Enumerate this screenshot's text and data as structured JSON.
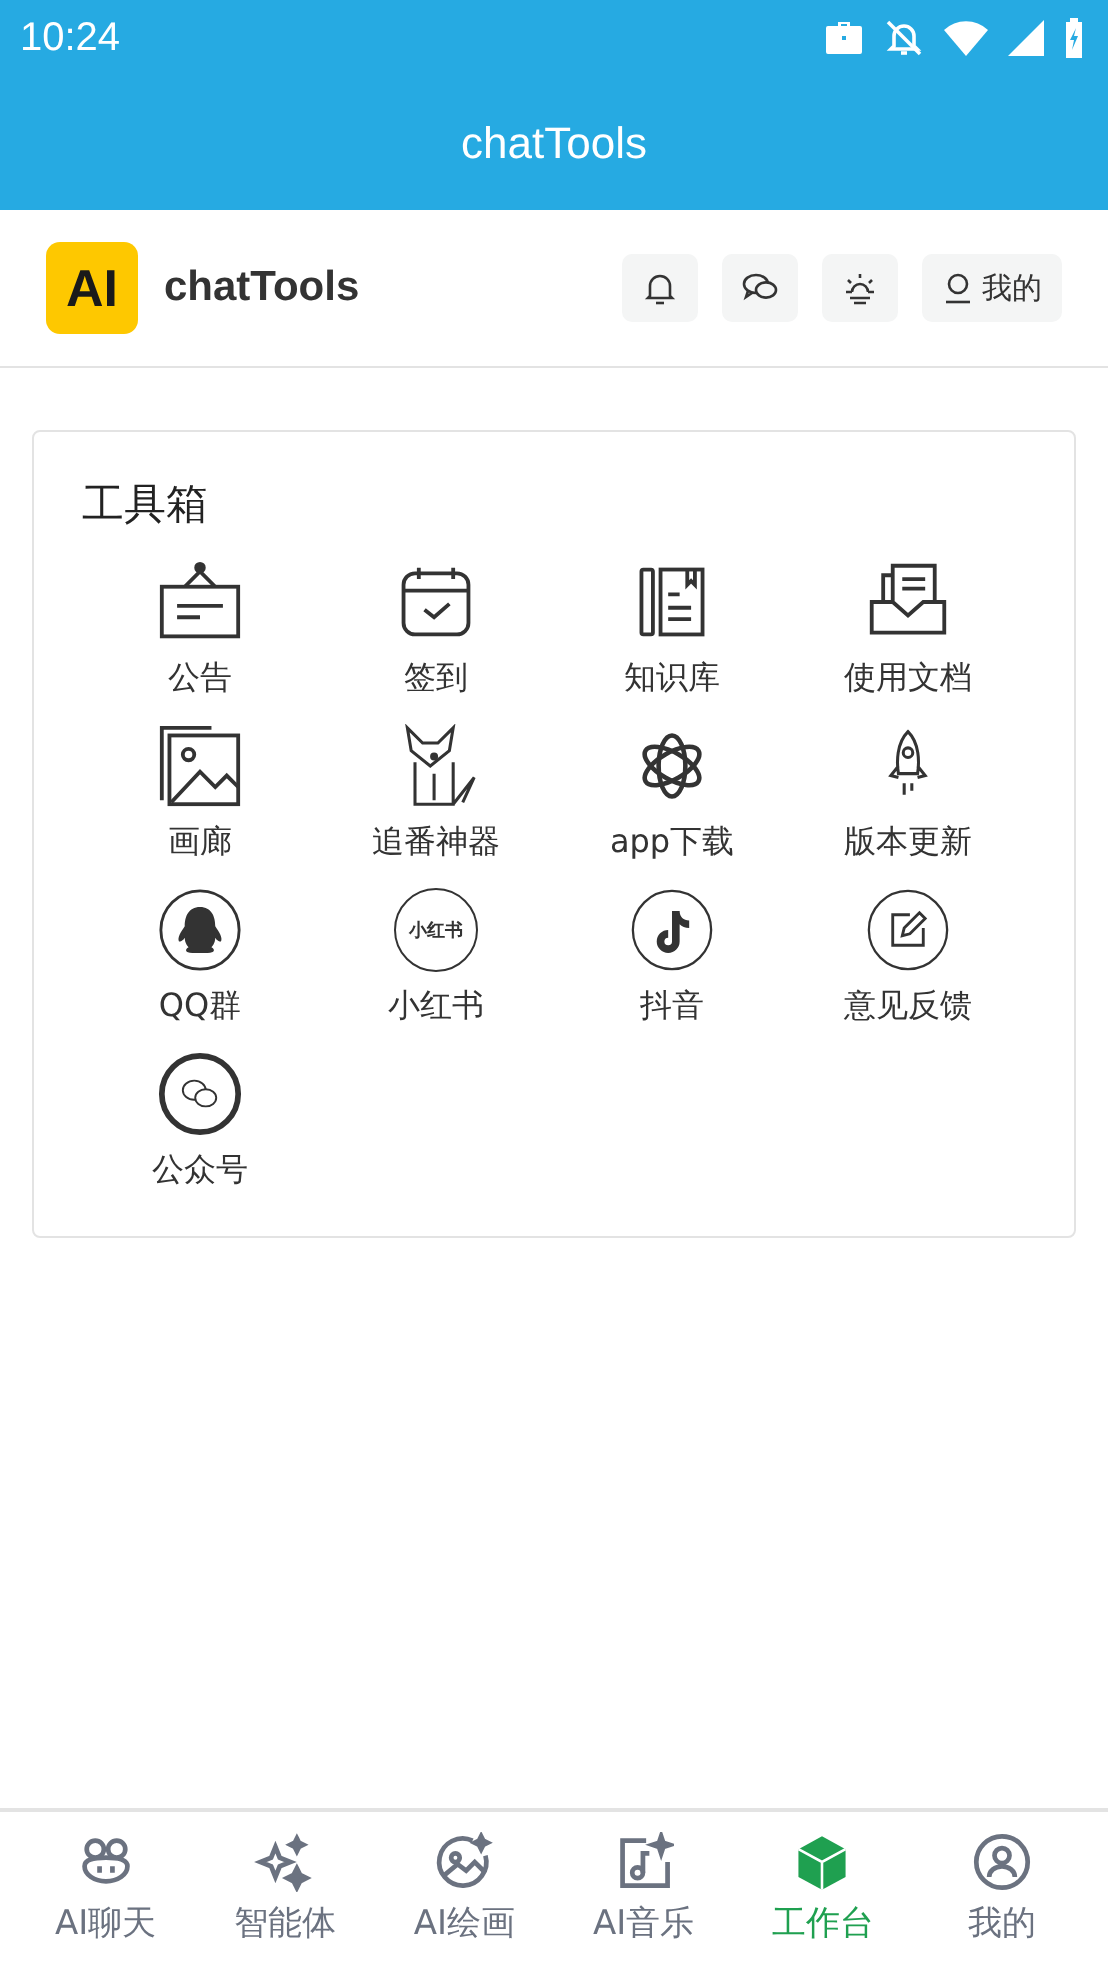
{
  "status_bar": {
    "time": "10:24"
  },
  "title_bar": {
    "title": "chatTools"
  },
  "app_header": {
    "logo_text": "AI",
    "name": "chatTools",
    "profile_label": "我的"
  },
  "toolbox": {
    "title": "工具箱",
    "tools": [
      {
        "label": "公告"
      },
      {
        "label": "签到"
      },
      {
        "label": "知识库"
      },
      {
        "label": "使用文档"
      },
      {
        "label": "画廊"
      },
      {
        "label": "追番神器"
      },
      {
        "label": "app下载"
      },
      {
        "label": "版本更新"
      },
      {
        "label": "QQ群"
      },
      {
        "label": "小红书",
        "logo_text": "小红书"
      },
      {
        "label": "抖音"
      },
      {
        "label": "意见反馈"
      },
      {
        "label": "公众号"
      }
    ]
  },
  "bottom_nav": [
    {
      "label": "AI聊天",
      "selected": false
    },
    {
      "label": "智能体",
      "selected": false
    },
    {
      "label": "AI绘画",
      "selected": false
    },
    {
      "label": "AI音乐",
      "selected": false
    },
    {
      "label": "工作台",
      "selected": true
    },
    {
      "label": "我的",
      "selected": false
    }
  ]
}
